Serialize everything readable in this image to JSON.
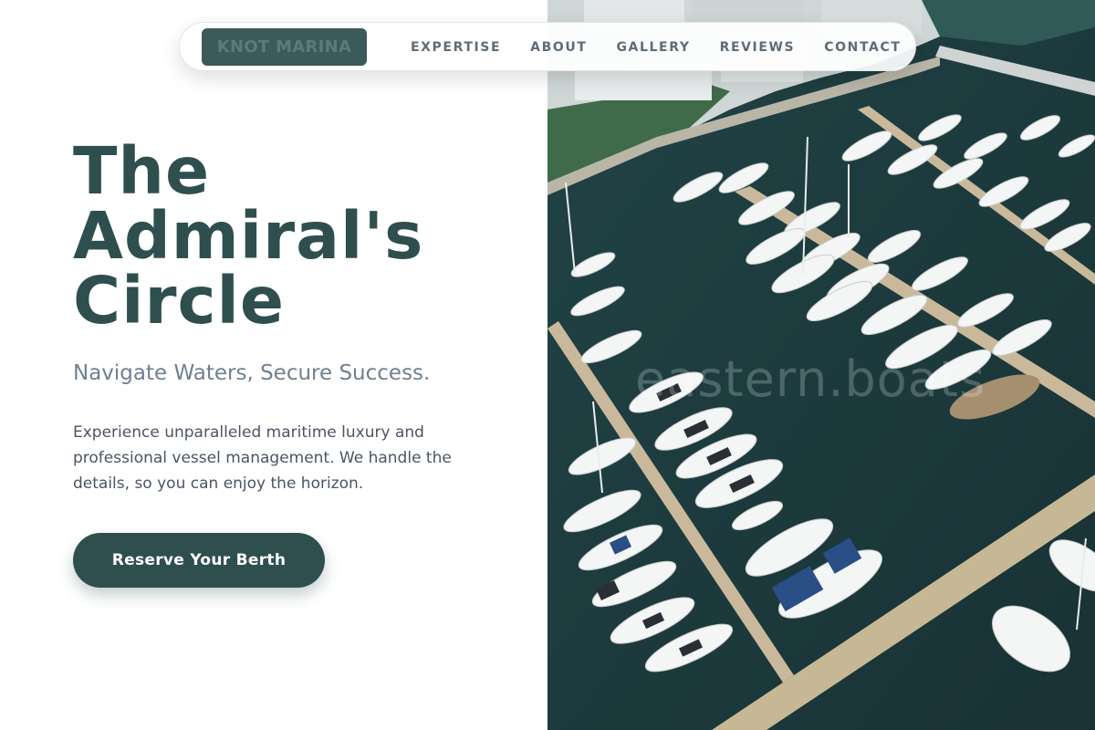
{
  "nav": {
    "logo": "KNOT MARINA",
    "links": [
      "EXPERTISE",
      "ABOUT",
      "GALLERY",
      "REVIEWS",
      "CONTACT"
    ]
  },
  "hero": {
    "title_lines": [
      "The",
      "Admiral's",
      "Circle"
    ],
    "subtitle": "Navigate Waters, Secure Success.",
    "body": "Experience unparalleled maritime luxury and professional vessel management. We handle the details, so you can enjoy the horizon.",
    "cta": "Reserve Your Berth"
  },
  "image": {
    "subject": "aerial-marina-photo",
    "watermark": "eastern.boats"
  },
  "colors": {
    "primary": "#2f4f4f",
    "subtitle": "#70808f",
    "body_text": "#4a5563",
    "nav_text": "#5e6c78",
    "water": "#1d3a3d"
  }
}
